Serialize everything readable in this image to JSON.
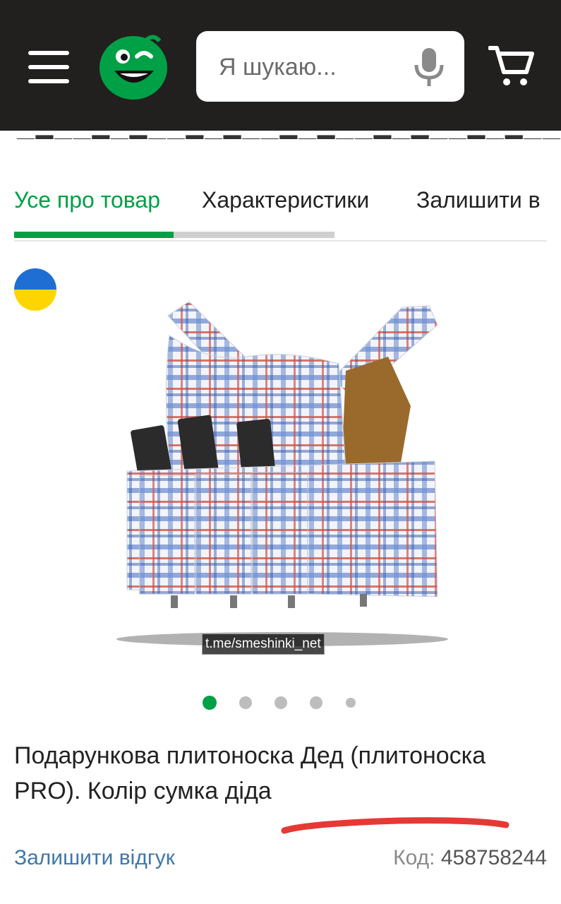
{
  "header": {
    "search": {
      "placeholder": "Я шукаю..."
    },
    "icons": {
      "menu": "hamburger-menu-icon",
      "logo": "smiley-logo",
      "mic": "microphone-icon",
      "cart": "cart-icon"
    }
  },
  "tabs": [
    {
      "label": "Усе про товар",
      "active": true
    },
    {
      "label": "Характеристики",
      "active": false
    },
    {
      "label": "Залишити в",
      "active": false
    }
  ],
  "gallery": {
    "watermark": "t.me/smeshinki_net",
    "slide_count": 5,
    "active_index": 0,
    "badge_icon": "ukraine-flag-icon"
  },
  "product": {
    "title": "Подарункова плитоноска Дед (плитоноска PRO). Колір сумка діда",
    "review_link": "Залишити відгук",
    "code_label": "Код:",
    "code_value": "458758244"
  },
  "colors": {
    "header_bg": "#221f1f",
    "accent_green": "#00a046",
    "link_blue": "#3e77aa",
    "annotation_red": "#e53935"
  }
}
